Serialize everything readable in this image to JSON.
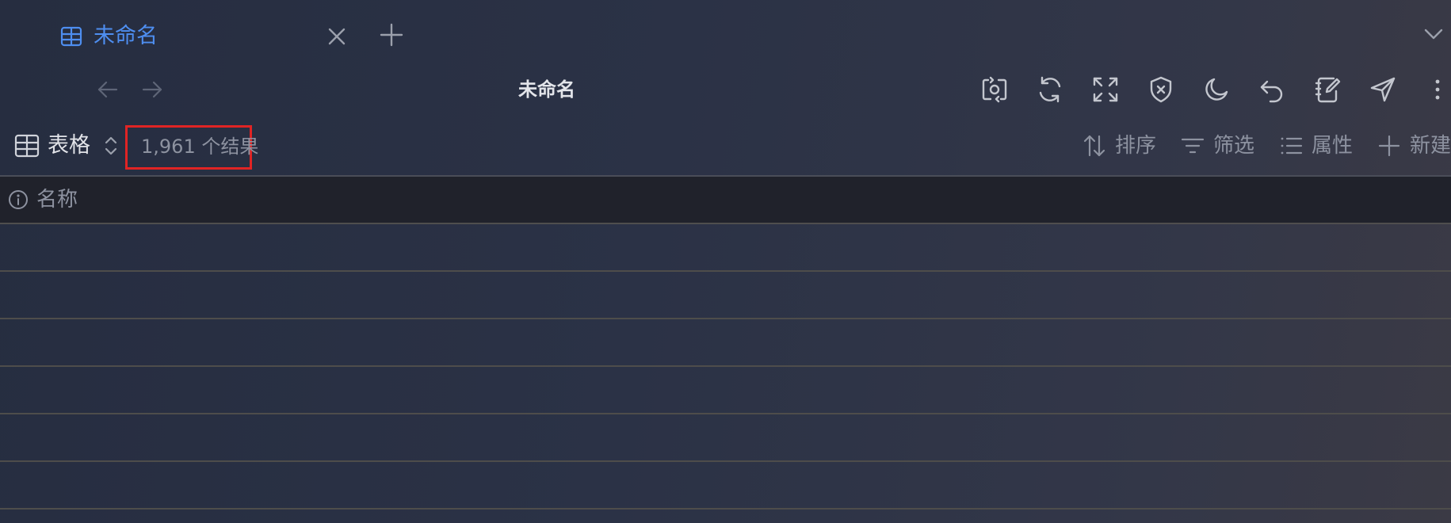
{
  "tab": {
    "title": "未命名",
    "icon": "table-icon"
  },
  "nav": {
    "title": "未命名"
  },
  "toolbar_icons": [
    "switch-capture-icon",
    "refresh-icon",
    "fullscreen-icon",
    "shield-x-icon",
    "dark-mode-icon",
    "undo-icon",
    "notebook-edit-icon",
    "send-icon",
    "more-vertical-icon"
  ],
  "view": {
    "label": "表格",
    "results_count": "1,961 个结果"
  },
  "actions": {
    "sort": "排序",
    "filter": "筛选",
    "properties": "属性",
    "new": "新建"
  },
  "table": {
    "column_name": "名称",
    "visible_row_count": 6
  },
  "colors": {
    "accent": "#4e8ef0",
    "highlight_box": "#e02424"
  }
}
